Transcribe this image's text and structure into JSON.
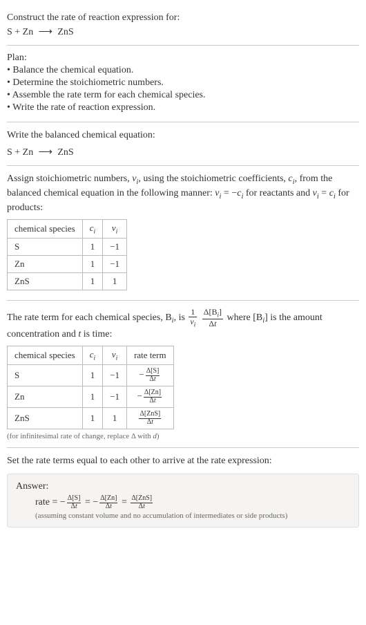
{
  "prompt": {
    "line1": "Construct the rate of reaction expression for:",
    "equation_lhs": "S + Zn",
    "equation_arrow": "⟶",
    "equation_rhs": "ZnS"
  },
  "plan": {
    "title": "Plan:",
    "bullets": [
      "• Balance the chemical equation.",
      "• Determine the stoichiometric numbers.",
      "• Assemble the rate term for each chemical species.",
      "• Write the rate of reaction expression."
    ]
  },
  "balanced": {
    "intro": "Write the balanced chemical equation:",
    "equation_lhs": "S + Zn",
    "equation_arrow": "⟶",
    "equation_rhs": "ZnS"
  },
  "stoich": {
    "intro_1": "Assign stoichiometric numbers, ",
    "nu_i": "ν",
    "nu_sub": "i",
    "intro_2": ", using the stoichiometric coefficients, ",
    "c_i": "c",
    "c_sub": "i",
    "intro_3": ", from the balanced chemical equation in the following manner: ",
    "rule_react_lhs": "ν",
    "rule_react_eq": " = −",
    "rule_react_rhs": "c",
    "rule_react_sub": "i",
    "intro_4": " for reactants and ",
    "rule_prod_lhs": "ν",
    "rule_prod_eq": " = ",
    "rule_prod_rhs": "c",
    "intro_5": " for products:",
    "headers": {
      "species": "chemical species",
      "ci": "c",
      "ci_sub": "i",
      "nui": "ν",
      "nui_sub": "i"
    },
    "rows": [
      {
        "species": "S",
        "ci": "1",
        "nui": "−1"
      },
      {
        "species": "Zn",
        "ci": "1",
        "nui": "−1"
      },
      {
        "species": "ZnS",
        "ci": "1",
        "nui": "1"
      }
    ]
  },
  "rate_term": {
    "intro_1": "The rate term for each chemical species, B",
    "intro_1_sub": "i",
    "intro_2": ", is ",
    "frac1_num": "1",
    "frac1_den_sym": "ν",
    "frac1_den_sub": "i",
    "frac2_num": "Δ[B",
    "frac2_num_sub": "i",
    "frac2_num_close": "]",
    "frac2_den": "Δt",
    "intro_3": " where [B",
    "intro_3_sub": "i",
    "intro_4": "] is the amount concentration and ",
    "t_sym": "t",
    "intro_5": " is time:",
    "headers": {
      "species": "chemical species",
      "ci": "c",
      "ci_sub": "i",
      "nui": "ν",
      "nui_sub": "i",
      "rate": "rate term"
    },
    "rows": [
      {
        "species": "S",
        "ci": "1",
        "nui": "−1",
        "sign": "−",
        "num": "Δ[S]",
        "den": "Δt"
      },
      {
        "species": "Zn",
        "ci": "1",
        "nui": "−1",
        "sign": "−",
        "num": "Δ[Zn]",
        "den": "Δt"
      },
      {
        "species": "ZnS",
        "ci": "1",
        "nui": "1",
        "sign": "",
        "num": "Δ[ZnS]",
        "den": "Δt"
      }
    ],
    "note": "(for infinitesimal rate of change, replace Δ with d)"
  },
  "final": {
    "intro": "Set the rate terms equal to each other to arrive at the rate expression:",
    "answer_label": "Answer:",
    "rate_word": "rate = ",
    "terms": [
      {
        "sign": "−",
        "num": "Δ[S]",
        "den": "Δt"
      },
      {
        "sign": "−",
        "num": "Δ[Zn]",
        "den": "Δt"
      },
      {
        "sign": "",
        "num": "Δ[ZnS]",
        "den": "Δt"
      }
    ],
    "eq_sep": " = ",
    "note": "(assuming constant volume and no accumulation of intermediates or side products)"
  }
}
